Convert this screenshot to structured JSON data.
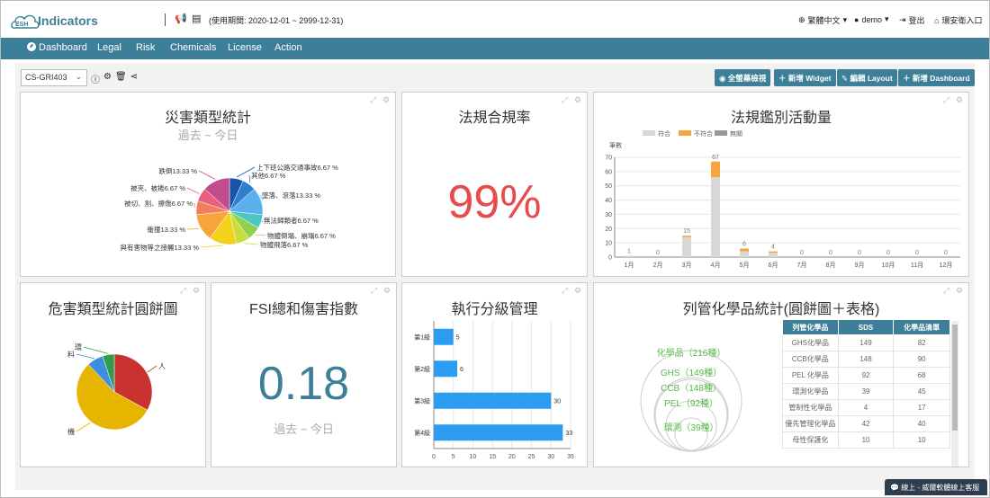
{
  "app": {
    "logo_text": "Indicators",
    "logo_mark": "ESH",
    "period": "(使用期間: 2020-12-01 ~ 2999-12-31)"
  },
  "topbar": {
    "language": "繁體中文",
    "user": "demo",
    "logout": "登出",
    "home": "環安衛入口"
  },
  "nav": [
    "Dashboard",
    "Legal",
    "Risk",
    "Chemicals",
    "License",
    "Action"
  ],
  "toolbar": {
    "selected": "CS-GRI403",
    "buttons": [
      "全螢幕檢視",
      "新增 Widget",
      "編輯 Layout",
      "新增 Dashboard"
    ]
  },
  "panels": {
    "disaster": {
      "title": "災害類型統計",
      "subtitle": "過去 ~ 今日",
      "chart_data": {
        "type": "pie",
        "labels": [
          "上下班公路交通事故",
          "其他",
          "墜落、滾落",
          "無法歸類者",
          "物體倒塌、崩塌",
          "物體飛落",
          "與有害物等之接觸",
          "衝撞",
          "被切、割、擦傷",
          "被夾、被捲",
          "跌倒"
        ],
        "values": [
          6.67,
          6.67,
          13.33,
          6.67,
          6.67,
          6.67,
          13.33,
          13.33,
          6.67,
          6.67,
          13.33
        ],
        "label_text": [
          "上下班公路交通事故6.67 %",
          "其他6.67 %",
          "墜落、滾落13.33 %",
          "無法歸類者6.67 %",
          "物體倒塌、崩塌6.67 %",
          "物體飛落6.67 %",
          "與有害物等之接觸13.33 %",
          "衝撞13.33 %",
          "被切、割、擦傷6.67 %",
          "被夾、被捲6.67 %",
          "跌倒13.33 %"
        ],
        "colors": [
          "#1a56a8",
          "#2f7fd1",
          "#5bb0ec",
          "#4cc6c0",
          "#8fd14f",
          "#c8dc3c",
          "#f2d21b",
          "#f6a43c",
          "#f07f5f",
          "#e8607a",
          "#c24d8c"
        ]
      }
    },
    "compliance": {
      "title": "法規合規率",
      "value": "99%"
    },
    "legal_activity": {
      "title": "法規鑑別活動量",
      "chart_data": {
        "type": "bar",
        "ylabel": "筆數",
        "categories": [
          "1月",
          "2月",
          "3月",
          "4月",
          "5月",
          "6月",
          "7月",
          "8月",
          "9月",
          "10月",
          "11月",
          "12月"
        ],
        "series": [
          {
            "name": "符合",
            "color": "#d8d8d8",
            "values": [
              1,
              0,
              14,
              56,
              4,
              3,
              0,
              0,
              0,
              0,
              0,
              0
            ]
          },
          {
            "name": "不符合",
            "color": "#f5a640",
            "values": [
              0,
              0,
              1,
              11,
              2,
              1,
              0,
              0,
              0,
              0,
              0,
              0
            ]
          },
          {
            "name": "無關",
            "color": "#999999",
            "values": [
              0,
              0,
              0,
              0,
              0,
              0,
              0,
              0,
              0,
              0,
              0,
              0
            ]
          }
        ],
        "totals": [
          1,
          0,
          15,
          67,
          6,
          4,
          0,
          0,
          0,
          0,
          0,
          0
        ],
        "yticks": [
          0,
          10,
          20,
          30,
          40,
          50,
          60,
          70
        ],
        "ylim": [
          0,
          70
        ]
      }
    },
    "hazard": {
      "title": "危害類型統計圓餅圖",
      "chart_data": {
        "type": "pie",
        "labels": [
          "人",
          "機",
          "料",
          "環"
        ],
        "values": [
          33,
          55,
          7,
          5
        ],
        "colors": [
          "#c8322f",
          "#e5b500",
          "#3d8ede",
          "#2f9e4a"
        ]
      }
    },
    "fsi": {
      "title": "FSI總和傷害指數",
      "value": "0.18",
      "subtitle": "過去 ~ 今日"
    },
    "level": {
      "title": "執行分級管理",
      "chart_data": {
        "type": "bar",
        "orientation": "horizontal",
        "categories": [
          "第1級",
          "第2級",
          "第3級",
          "第4級"
        ],
        "values": [
          5,
          6,
          30,
          33
        ],
        "xticks": [
          0,
          5,
          10,
          15,
          20,
          25,
          30,
          35
        ],
        "xlim": [
          0,
          35
        ]
      }
    },
    "chemicals": {
      "title": "列管化學品統計(圓餅圖＋表格)",
      "circle_labels": [
        "化學品（216種）",
        "GHS（149種）",
        "CCB（148種）",
        "PEL（92種）",
        "環測（39種）"
      ],
      "table": {
        "headers": [
          "列管化學品",
          "SDS",
          "化學品清單"
        ],
        "rows": [
          [
            "GHS化學品",
            "149",
            "82"
          ],
          [
            "CCB化學品",
            "148",
            "90"
          ],
          [
            "PEL 化學品",
            "92",
            "68"
          ],
          [
            "環測化學品",
            "39",
            "45"
          ],
          [
            "管制性化學品",
            "4",
            "17"
          ],
          [
            "優先管理化學品",
            "42",
            "40"
          ],
          [
            "母性保護化",
            "10",
            "10"
          ]
        ]
      }
    }
  },
  "chat": "線上 - 威爾軟體線上客服"
}
